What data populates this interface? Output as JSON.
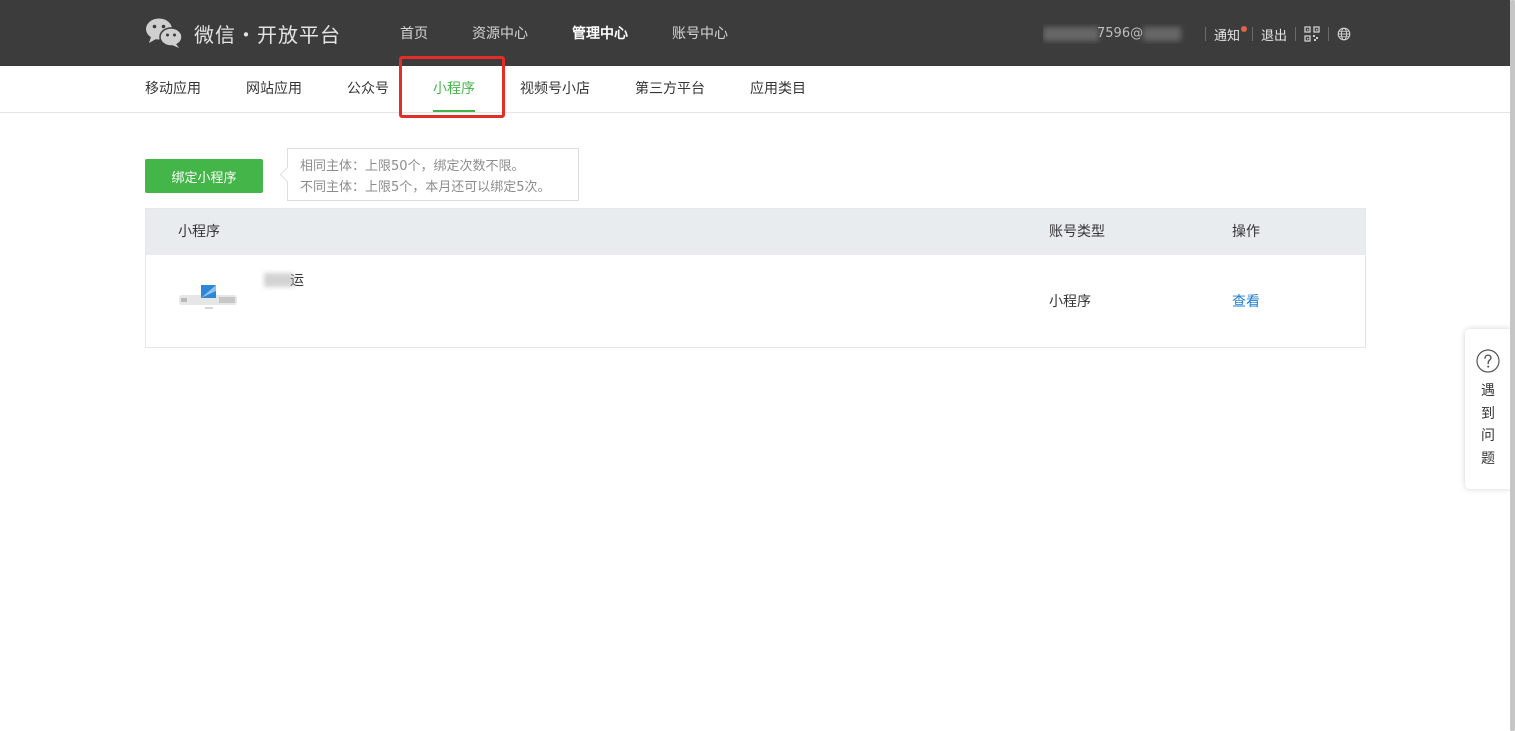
{
  "brand": {
    "title": "微信・开放平台"
  },
  "main_nav": [
    {
      "label": "首页",
      "active": false
    },
    {
      "label": "资源中心",
      "active": false
    },
    {
      "label": "管理中心",
      "active": true
    },
    {
      "label": "账号中心",
      "active": false
    }
  ],
  "user": {
    "account_partial": "7596@",
    "notice_label": "通知",
    "logout_label": "退出"
  },
  "sub_nav": [
    {
      "label": "移动应用",
      "active": false
    },
    {
      "label": "网站应用",
      "active": false
    },
    {
      "label": "公众号",
      "active": false
    },
    {
      "label": "小程序",
      "active": true
    },
    {
      "label": "视频号小店",
      "active": false
    },
    {
      "label": "第三方平台",
      "active": false
    },
    {
      "label": "应用类目",
      "active": false
    }
  ],
  "actions": {
    "bind_label": "绑定小程序",
    "tip_line1": "相同主体：上限50个，绑定次数不限。",
    "tip_line2": "不同主体：上限5个，本月还可以绑定5次。"
  },
  "table": {
    "headers": {
      "name": "小程序",
      "type": "账号类型",
      "action": "操作"
    },
    "rows": [
      {
        "name_suffix": "运",
        "type": "小程序",
        "action": "查看"
      }
    ]
  },
  "help": {
    "label": "遇到问题"
  },
  "colors": {
    "topbar": "#3c3c3c",
    "accent_green": "#44b549",
    "link_blue": "#1f7ed2",
    "highlight_red": "#e52d27",
    "notice_dot": "#e0634a"
  },
  "icons": [
    "wechat-logo-icon",
    "qrcode-icon",
    "globe-icon",
    "question-icon"
  ]
}
